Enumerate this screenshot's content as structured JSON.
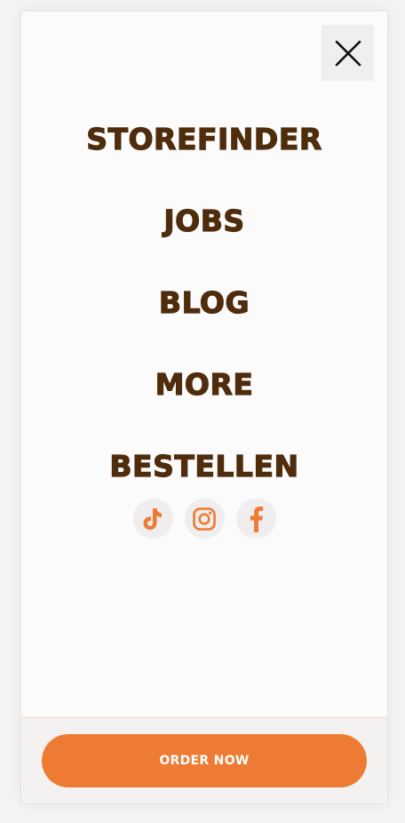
{
  "menu": {
    "close_icon": "close-icon",
    "items": [
      {
        "label": "STOREFINDER"
      },
      {
        "label": "JOBS"
      },
      {
        "label": "BLOG"
      },
      {
        "label": "MORE"
      },
      {
        "label": "BESTELLEN"
      }
    ]
  },
  "social": [
    {
      "icon": "tiktok-icon"
    },
    {
      "icon": "instagram-icon"
    },
    {
      "icon": "facebook-icon"
    }
  ],
  "footer": {
    "order_label": "ORDER NOW"
  },
  "colors": {
    "brand_brown": "#4e2c0c",
    "accent_orange": "#ee7b33",
    "panel_bg": "#fcfbfb"
  }
}
